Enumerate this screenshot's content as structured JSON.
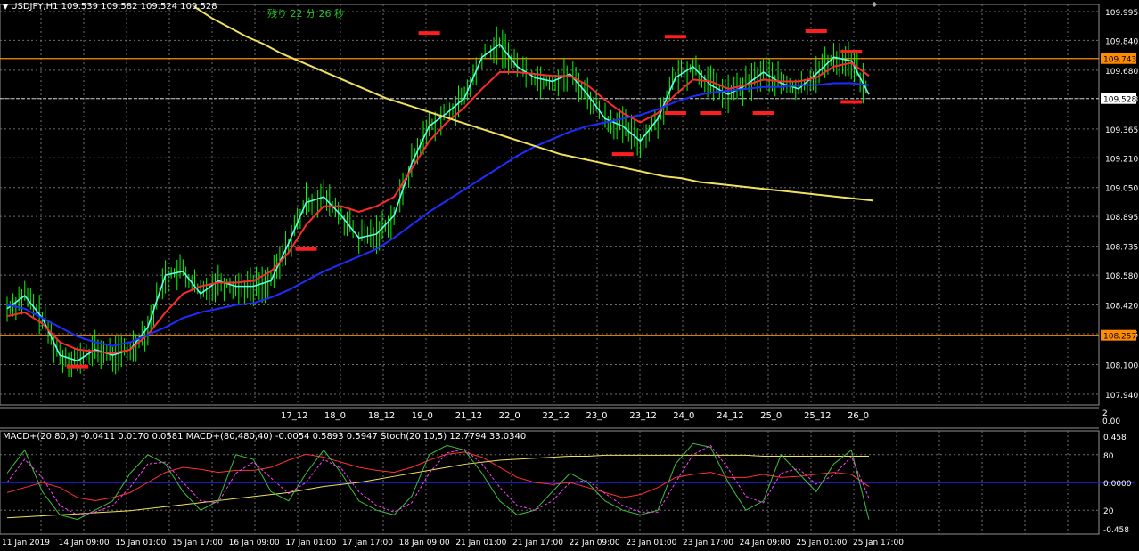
{
  "header": {
    "symbol_line": "USDJPY,H1  109.539 109.582 109.524 109.528",
    "countdown": "残り 22 分 26 秒"
  },
  "indicator_header": "MACD+(20,80,9) -0.0411 0.0170 0.0581  MACD+(80,480,40) -0.0054 0.5893 0.5947  Stoch(20,10,5) 12.7794 33.0340",
  "colors": {
    "background": "#000000",
    "grid": "#6e6e6e",
    "candle": "#00ff00",
    "fast_ma": "#5dfcf0",
    "mid_ma": "#ff2a2a",
    "slow_ma": "#1e2dff",
    "long_ma": "#f0e060",
    "hline": "#ff8c00",
    "price_line": "#c8c8c8",
    "marker": "#ff1e1e",
    "macd_fast": "#ff3030",
    "macd_slow_hist": "#f0e060",
    "stoch_main": "#3fbf3f",
    "stoch_signal": "#ff40ff",
    "zero_line": "#2020ff"
  },
  "chart_data": [
    {
      "type": "line",
      "title": "USDJPY,H1",
      "ylim": [
        107.94,
        109.995
      ],
      "price_axis_ticks": [
        "109.995",
        "109.840",
        "109.680",
        "109.528",
        "109.365",
        "109.210",
        "109.050",
        "108.895",
        "108.735",
        "108.580",
        "108.420",
        "108.265",
        "108.100",
        "107.940"
      ],
      "horizontal_lines": [
        {
          "value": 109.743,
          "label": "109.743"
        },
        {
          "value": 108.257,
          "label": "108.257"
        }
      ],
      "current_price": {
        "value": 109.528,
        "label": "109.528"
      },
      "upper_time_labels": [
        "17_12",
        "18_0",
        "18_12",
        "19_0",
        "21_12",
        "22_0",
        "22_12",
        "23_0",
        "23_12",
        "24_0",
        "24_12",
        "25_0",
        "25_12",
        "26_0"
      ],
      "series": [
        {
          "name": "fast_ma",
          "values": [
            108.4,
            108.47,
            108.35,
            108.15,
            108.12,
            108.18,
            108.15,
            108.18,
            108.3,
            108.58,
            108.6,
            108.48,
            108.55,
            108.52,
            108.52,
            108.55,
            108.75,
            108.97,
            109.0,
            108.9,
            108.78,
            108.8,
            108.9,
            109.18,
            109.38,
            109.45,
            109.53,
            109.75,
            109.82,
            109.7,
            109.64,
            109.62,
            109.66,
            109.55,
            109.42,
            109.38,
            109.3,
            109.42,
            109.64,
            109.7,
            109.6,
            109.55,
            109.6,
            109.67,
            109.61,
            109.58,
            109.66,
            109.75,
            109.73,
            109.55
          ]
        },
        {
          "name": "mid_ma",
          "values": [
            108.36,
            108.38,
            108.32,
            108.22,
            108.18,
            108.17,
            108.16,
            108.18,
            108.26,
            108.38,
            108.48,
            108.52,
            108.54,
            108.54,
            108.55,
            108.6,
            108.7,
            108.85,
            108.95,
            108.95,
            108.92,
            108.95,
            109.0,
            109.15,
            109.3,
            109.4,
            109.48,
            109.58,
            109.67,
            109.67,
            109.66,
            109.65,
            109.65,
            109.6,
            109.52,
            109.45,
            109.4,
            109.45,
            109.55,
            109.63,
            109.62,
            109.58,
            109.6,
            109.63,
            109.62,
            109.62,
            109.64,
            109.7,
            109.72,
            109.65
          ]
        },
        {
          "name": "slow_ma",
          "values": [
            108.42,
            108.4,
            108.35,
            108.3,
            108.25,
            108.22,
            108.2,
            108.22,
            108.26,
            108.3,
            108.35,
            108.38,
            108.4,
            108.42,
            108.43,
            108.46,
            108.5,
            108.55,
            108.6,
            108.64,
            108.68,
            108.72,
            108.78,
            108.85,
            108.92,
            108.98,
            109.04,
            109.1,
            109.16,
            109.22,
            109.27,
            109.31,
            109.35,
            109.38,
            109.4,
            109.42,
            109.44,
            109.47,
            109.51,
            109.54,
            109.56,
            109.57,
            109.58,
            109.59,
            109.59,
            109.6,
            109.6,
            109.61,
            109.61,
            109.6
          ]
        },
        {
          "name": "long_ma",
          "values": [
            110.3,
            110.22,
            110.15,
            110.08,
            110.02,
            109.96,
            109.91,
            109.86,
            109.82,
            109.77,
            109.73,
            109.69,
            109.65,
            109.61,
            109.57,
            109.53,
            109.5,
            109.47,
            109.44,
            109.41,
            109.38,
            109.35,
            109.32,
            109.29,
            109.26,
            109.23,
            109.21,
            109.19,
            109.17,
            109.15,
            109.13,
            109.11,
            109.1,
            109.08,
            109.07,
            109.06,
            109.05,
            109.04,
            109.03,
            109.02,
            109.01,
            109.0,
            108.99,
            108.98
          ]
        }
      ],
      "markers": [
        {
          "bar": 4,
          "value": 108.09
        },
        {
          "bar": 17,
          "value": 108.72
        },
        {
          "bar": 24,
          "value": 109.88
        },
        {
          "bar": 35,
          "value": 109.23
        },
        {
          "bar": 38,
          "value": 109.86
        },
        {
          "bar": 38,
          "value": 109.45
        },
        {
          "bar": 40,
          "value": 109.45
        },
        {
          "bar": 43,
          "value": 109.45
        },
        {
          "bar": 46,
          "value": 109.89
        },
        {
          "bar": 48,
          "value": 109.78
        },
        {
          "bar": 48,
          "value": 109.51
        }
      ]
    },
    {
      "type": "line",
      "title": "MACD+ / Stoch",
      "ylim": [
        -0.458,
        0.458
      ],
      "axis_ticks": [
        "0.458",
        "80",
        "0.0000",
        "20",
        "-0.458"
      ],
      "secondary_ticks": [
        "2",
        "0.00"
      ],
      "x_labels": [
        "11 Jan 2019",
        "14 Jan 09:00",
        "15 Jan 01:00",
        "15 Jan 17:00",
        "16 Jan 09:00",
        "17 Jan 01:00",
        "17 Jan 17:00",
        "18 Jan 09:00",
        "21 Jan 01:00",
        "21 Jan 17:00",
        "22 Jan 09:00",
        "23 Jan 01:00",
        "23 Jan 17:00",
        "24 Jan 09:00",
        "25 Jan 01:00",
        "25 Jan 17:00"
      ],
      "series": [
        {
          "name": "MACD+(20,80,9)",
          "values": [
            -0.1,
            -0.05,
            0.0,
            -0.05,
            -0.15,
            -0.18,
            -0.15,
            -0.1,
            0.0,
            0.1,
            0.15,
            0.13,
            0.1,
            0.12,
            0.12,
            0.15,
            0.22,
            0.28,
            0.25,
            0.2,
            0.15,
            0.12,
            0.1,
            0.15,
            0.22,
            0.28,
            0.3,
            0.25,
            0.15,
            0.05,
            0.0,
            -0.02,
            0.0,
            -0.05,
            -0.1,
            -0.15,
            -0.12,
            -0.05,
            0.05,
            0.08,
            0.1,
            0.05,
            0.05,
            0.08,
            0.05,
            0.06,
            0.08,
            0.1,
            0.08,
            -0.04
          ]
        },
        {
          "name": "MACD+(80,480,40)",
          "values": [
            -0.35,
            -0.34,
            -0.33,
            -0.32,
            -0.31,
            -0.3,
            -0.29,
            -0.28,
            -0.26,
            -0.24,
            -0.22,
            -0.2,
            -0.18,
            -0.16,
            -0.14,
            -0.12,
            -0.1,
            -0.07,
            -0.04,
            -0.02,
            0.0,
            0.03,
            0.06,
            0.09,
            0.12,
            0.15,
            0.18,
            0.2,
            0.22,
            0.23,
            0.24,
            0.25,
            0.26,
            0.26,
            0.27,
            0.27,
            0.27,
            0.27,
            0.27,
            0.27,
            0.27,
            0.27,
            0.27,
            0.26,
            0.26,
            0.26,
            0.26,
            0.26,
            0.26,
            0.26
          ]
        },
        {
          "name": "Stoch main",
          "values": [
            60,
            85,
            40,
            15,
            10,
            20,
            30,
            60,
            80,
            70,
            40,
            20,
            30,
            80,
            75,
            40,
            30,
            60,
            85,
            60,
            30,
            20,
            15,
            35,
            80,
            90,
            85,
            60,
            30,
            15,
            20,
            40,
            60,
            50,
            30,
            20,
            15,
            20,
            70,
            92,
            88,
            50,
            20,
            30,
            80,
            60,
            40,
            70,
            85,
            10
          ]
        },
        {
          "name": "Stoch signal",
          "values": [
            50,
            75,
            55,
            25,
            15,
            18,
            25,
            45,
            70,
            72,
            50,
            30,
            28,
            60,
            72,
            55,
            38,
            50,
            75,
            65,
            40,
            25,
            18,
            28,
            60,
            82,
            86,
            70,
            45,
            25,
            20,
            30,
            50,
            52,
            38,
            25,
            18,
            18,
            50,
            80,
            90,
            65,
            35,
            28,
            60,
            65,
            48,
            58,
            78,
            33
          ]
        }
      ]
    }
  ]
}
